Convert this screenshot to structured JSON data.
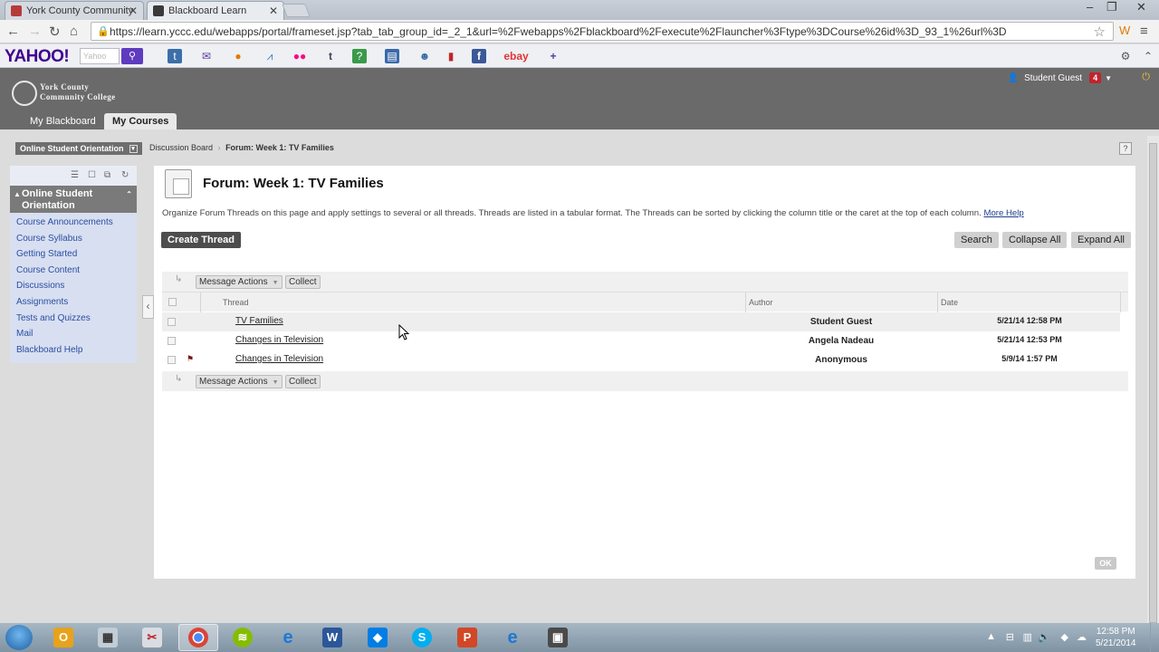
{
  "browser": {
    "tabs": [
      {
        "label": "York County Community",
        "active": false
      },
      {
        "label": "Blackboard Learn",
        "active": true
      }
    ],
    "url": "https://learn.yccc.edu/webapps/portal/frameset.jsp?tab_tab_group_id=_2_1&url=%2Fwebapps%2Fblackboard%2Fexecute%2Flauncher%3Ftype%3DCourse%26id%3D_93_1%26url%3D"
  },
  "yahoo": {
    "logo": "YAHOO!",
    "search_placeholder": "Yahoo"
  },
  "header": {
    "logo_line1": "York County",
    "logo_line2": "Community College",
    "user_name": "Student Guest",
    "notification_count": "4",
    "tabs": [
      {
        "label": "My Blackboard"
      },
      {
        "label": "My Courses"
      }
    ]
  },
  "breadcrumb": {
    "course": "Online Student Orientation",
    "items": [
      "Discussion Board",
      "Forum: Week 1: TV Families"
    ],
    "help": "?"
  },
  "course_menu": {
    "title": "Online Student Orientation",
    "links": [
      "Course Announcements",
      "Course Syllabus",
      "Getting Started",
      "Course Content",
      "Discussions",
      "Assignments",
      "Tests and Quizzes",
      "Mail",
      "Blackboard Help"
    ]
  },
  "page": {
    "title": "Forum: Week 1: TV Families",
    "instructions": "Organize Forum Threads on this page and apply settings to several or all threads. Threads are listed in a tabular format. The Threads can be sorted by clicking the column title or the caret at the top of each column.",
    "more_help": "More Help",
    "create_thread": "Create Thread",
    "search": "Search",
    "collapse_all": "Collapse All",
    "expand_all": "Expand All",
    "message_actions": "Message Actions",
    "collect": "Collect",
    "ok": "OK"
  },
  "table": {
    "columns": {
      "thread": "Thread",
      "author": "Author",
      "date": "Date"
    },
    "rows": [
      {
        "thread": "TV Families",
        "author": "Student Guest",
        "date": "5/21/14 12:58 PM",
        "flagged": false
      },
      {
        "thread": "Changes in Television",
        "author": "Angela Nadeau",
        "date": "5/21/14 12:53 PM",
        "flagged": false
      },
      {
        "thread": "Changes in Television",
        "author": "Anonymous",
        "date": "5/9/14 1:57 PM",
        "flagged": true
      }
    ]
  },
  "taskbar": {
    "time": "12:58 PM",
    "date": "5/21/2014"
  },
  "colors": {
    "header_gray": "#6a6a6a",
    "menu_bg": "#d8dff1",
    "link_blue": "#2a4ea1",
    "badge_red": "#c0242b"
  }
}
